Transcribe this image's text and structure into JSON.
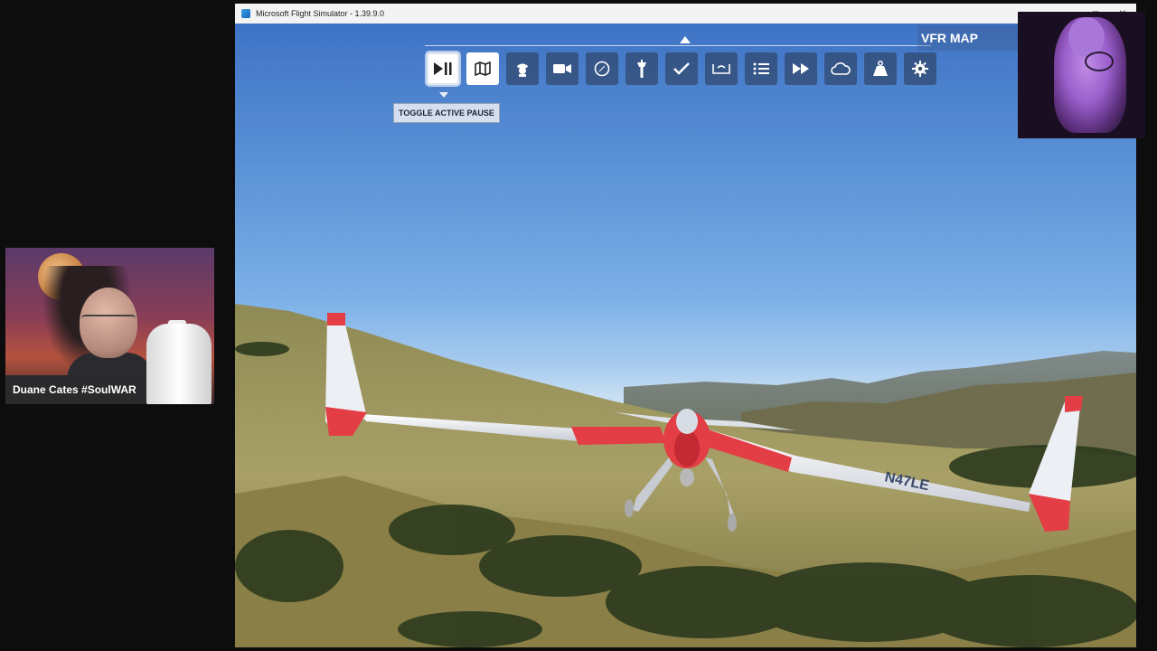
{
  "window": {
    "title": "Microsoft Flight Simulator - 1.39.9.0",
    "controls": [
      "minimize",
      "maximize",
      "close"
    ]
  },
  "toolbar": {
    "tooltip": "TOGGLE ACTIVE PAUSE",
    "panel_label": "VFR MAP",
    "buttons": [
      {
        "name": "toggle-active-pause",
        "icon": "play-pause-icon",
        "state": "selected"
      },
      {
        "name": "vfr-map",
        "icon": "map-icon",
        "state": "active"
      },
      {
        "name": "atc",
        "icon": "pilot-icon"
      },
      {
        "name": "camera",
        "icon": "camera-icon"
      },
      {
        "name": "navlog",
        "icon": "compass-icon"
      },
      {
        "name": "control-tower",
        "icon": "tower-icon"
      },
      {
        "name": "checklist",
        "icon": "checkmark-icon"
      },
      {
        "name": "fuel-payload",
        "icon": "weight-icon"
      },
      {
        "name": "objectives",
        "icon": "list-icon"
      },
      {
        "name": "sim-rate",
        "icon": "fast-forward-icon"
      },
      {
        "name": "weather",
        "icon": "cloud-icon"
      },
      {
        "name": "assistance",
        "icon": "kettlebell-icon"
      },
      {
        "name": "settings",
        "icon": "gear-icon"
      }
    ]
  },
  "webcam": {
    "name_tag": "Duane Cates #SoulWAR"
  },
  "aircraft": {
    "registration": "N47LE",
    "livery_colors": [
      "#e33d45",
      "#f2f2f2"
    ]
  }
}
